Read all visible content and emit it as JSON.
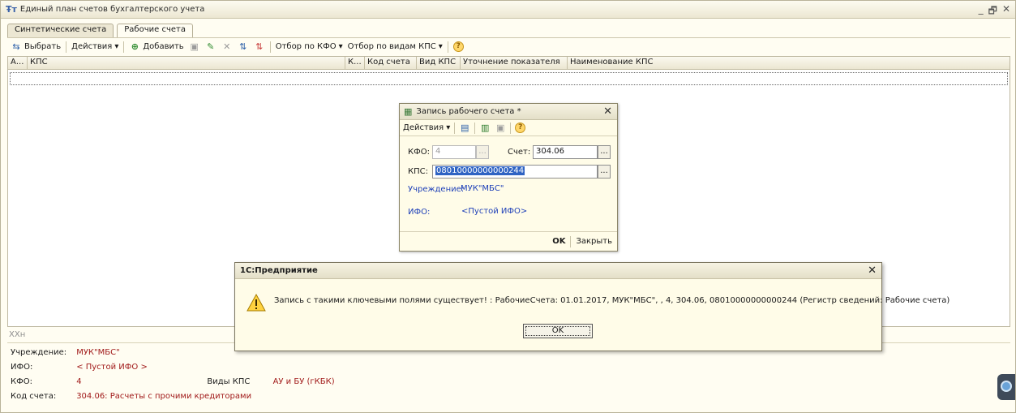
{
  "window": {
    "title": "Единый план счетов бухгалтерского учета",
    "app_glyph": "Ŧт"
  },
  "win_controls": {
    "minimize": "_",
    "restore": "🗗",
    "close": "✕"
  },
  "tabs": [
    {
      "label": "Синтетические счета",
      "active": false
    },
    {
      "label": "Рабочие счета",
      "active": true
    }
  ],
  "toolbar": {
    "select_label": "Выбрать",
    "actions_label": "Действия",
    "add_label": "Добавить",
    "filter_kfo_label": "Отбор по КФО",
    "filter_kps_label": "Отбор по видам КПС"
  },
  "grid": {
    "columns": [
      "А...",
      "КПС",
      "К...",
      "Код счета",
      "Вид КПС",
      "Уточнение показателя",
      "Наименование КПС"
    ]
  },
  "info_panel": {
    "header": "ХХн",
    "rows": [
      {
        "label": "Учреждение:",
        "value": "МУК\"МБС\""
      },
      {
        "label": "ИФО:",
        "value": "< Пустой ИФО >"
      },
      {
        "label": "КФО:",
        "value": "4",
        "extra_label": "Виды КПС",
        "extra_value": "АУ и БУ (гКБК)"
      },
      {
        "label": "Код счета:",
        "value": "304.06: Расчеты с прочими кредиторами"
      }
    ]
  },
  "dialog": {
    "title": "Запись рабочего счета *",
    "actions_label": "Действия",
    "kfo_label": "КФО:",
    "kfo_value": "4",
    "account_label": "Счет:",
    "account_value": "304.06",
    "kps_label": "КПС:",
    "kps_value": "08010000000000244",
    "institution_label": "Учреждение:",
    "institution_value": "МУК\"МБС\"",
    "ifo_label": "ИФО:",
    "ifo_value": "<Пустой ИФО>",
    "ok_label": "OK",
    "close_label": "Закрыть",
    "ellipsis": "..."
  },
  "messagebox": {
    "title": "1С:Предприятие",
    "text": "Запись с такими ключевыми полями существует! : РабочиеСчета: 01.01.2017, МУК\"МБС\", , 4, 304.06, 08010000000000244 (Регистр сведений: Рабочие счета)",
    "ok_label": "OK"
  },
  "colors": {
    "window_bg": "#fffdf2",
    "accent_blue": "#1d3fb8",
    "value_red": "#a11a1a",
    "selection": "#2f63c3"
  }
}
